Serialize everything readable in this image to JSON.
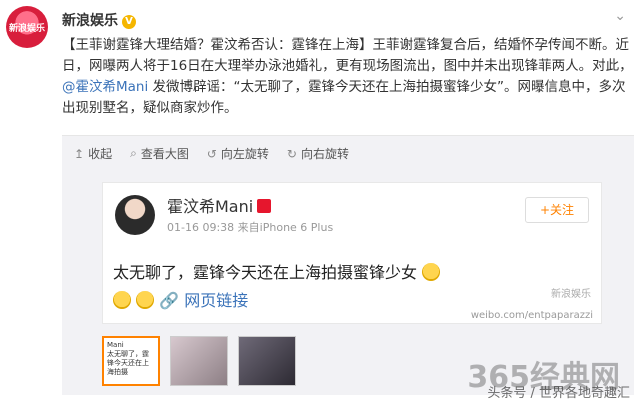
{
  "post": {
    "author": "新浪娱乐",
    "verified_badge": "V",
    "avatar_text": "新浪娱乐",
    "text_main": "【王菲谢霆锋大理结婚？霍汶希否认：霆锋在上海】王菲谢霆锋复合后，结婚怀孕传闻不断。近日，网曝两人将于16日在大理举办泳池婚礼，更有现场图流出，图中并未出现锋菲两人。对此，",
    "mention": "@霍汶希Mani",
    "text_tail": " 发微博辟谣：“太无聊了，霆锋今天还在上海拍摄蜜锋少女”。网曝信息中，多次出现别墅名，疑似商家炒作。"
  },
  "toolbar": {
    "collect": "收起",
    "view_large": "查看大图",
    "rotate_left": "向左旋转",
    "rotate_right": "向右旋转"
  },
  "card": {
    "name": "霍汶希Mani",
    "time": "01-16 09:38",
    "source": "来自iPhone 6 Plus",
    "follow": "+关注",
    "text": "太无聊了，霆锋今天还在上海拍摄蜜锋少女",
    "web_link": "网页链接",
    "image_mark": "新浪娱乐",
    "watermark": "weibo.com/entpaparazzi"
  },
  "thumbs": {
    "first_name": "Mani",
    "first_text": "太无聊了，霆锋今天还在上海拍摄"
  },
  "overlay": {
    "brand": "365经典网",
    "source": "头条号 / 世界各地奇趣汇"
  }
}
